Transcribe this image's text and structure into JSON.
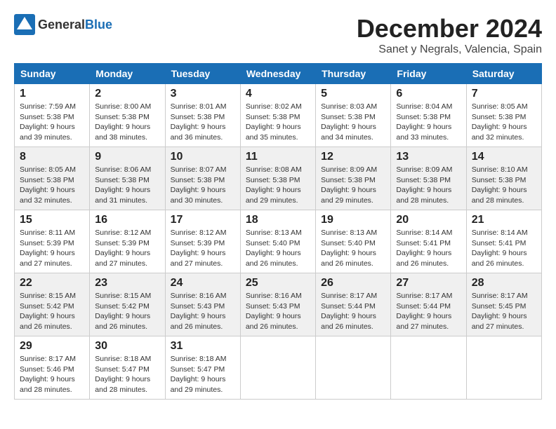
{
  "header": {
    "logo_general": "General",
    "logo_blue": "Blue",
    "month": "December 2024",
    "location": "Sanet y Negrals, Valencia, Spain"
  },
  "weekdays": [
    "Sunday",
    "Monday",
    "Tuesday",
    "Wednesday",
    "Thursday",
    "Friday",
    "Saturday"
  ],
  "weeks": [
    [
      {
        "day": "1",
        "sunrise": "Sunrise: 7:59 AM",
        "sunset": "Sunset: 5:38 PM",
        "daylight": "Daylight: 9 hours and 39 minutes."
      },
      {
        "day": "2",
        "sunrise": "Sunrise: 8:00 AM",
        "sunset": "Sunset: 5:38 PM",
        "daylight": "Daylight: 9 hours and 38 minutes."
      },
      {
        "day": "3",
        "sunrise": "Sunrise: 8:01 AM",
        "sunset": "Sunset: 5:38 PM",
        "daylight": "Daylight: 9 hours and 36 minutes."
      },
      {
        "day": "4",
        "sunrise": "Sunrise: 8:02 AM",
        "sunset": "Sunset: 5:38 PM",
        "daylight": "Daylight: 9 hours and 35 minutes."
      },
      {
        "day": "5",
        "sunrise": "Sunrise: 8:03 AM",
        "sunset": "Sunset: 5:38 PM",
        "daylight": "Daylight: 9 hours and 34 minutes."
      },
      {
        "day": "6",
        "sunrise": "Sunrise: 8:04 AM",
        "sunset": "Sunset: 5:38 PM",
        "daylight": "Daylight: 9 hours and 33 minutes."
      },
      {
        "day": "7",
        "sunrise": "Sunrise: 8:05 AM",
        "sunset": "Sunset: 5:38 PM",
        "daylight": "Daylight: 9 hours and 32 minutes."
      }
    ],
    [
      {
        "day": "8",
        "sunrise": "Sunrise: 8:05 AM",
        "sunset": "Sunset: 5:38 PM",
        "daylight": "Daylight: 9 hours and 32 minutes."
      },
      {
        "day": "9",
        "sunrise": "Sunrise: 8:06 AM",
        "sunset": "Sunset: 5:38 PM",
        "daylight": "Daylight: 9 hours and 31 minutes."
      },
      {
        "day": "10",
        "sunrise": "Sunrise: 8:07 AM",
        "sunset": "Sunset: 5:38 PM",
        "daylight": "Daylight: 9 hours and 30 minutes."
      },
      {
        "day": "11",
        "sunrise": "Sunrise: 8:08 AM",
        "sunset": "Sunset: 5:38 PM",
        "daylight": "Daylight: 9 hours and 29 minutes."
      },
      {
        "day": "12",
        "sunrise": "Sunrise: 8:09 AM",
        "sunset": "Sunset: 5:38 PM",
        "daylight": "Daylight: 9 hours and 29 minutes."
      },
      {
        "day": "13",
        "sunrise": "Sunrise: 8:09 AM",
        "sunset": "Sunset: 5:38 PM",
        "daylight": "Daylight: 9 hours and 28 minutes."
      },
      {
        "day": "14",
        "sunrise": "Sunrise: 8:10 AM",
        "sunset": "Sunset: 5:38 PM",
        "daylight": "Daylight: 9 hours and 28 minutes."
      }
    ],
    [
      {
        "day": "15",
        "sunrise": "Sunrise: 8:11 AM",
        "sunset": "Sunset: 5:39 PM",
        "daylight": "Daylight: 9 hours and 27 minutes."
      },
      {
        "day": "16",
        "sunrise": "Sunrise: 8:12 AM",
        "sunset": "Sunset: 5:39 PM",
        "daylight": "Daylight: 9 hours and 27 minutes."
      },
      {
        "day": "17",
        "sunrise": "Sunrise: 8:12 AM",
        "sunset": "Sunset: 5:39 PM",
        "daylight": "Daylight: 9 hours and 27 minutes."
      },
      {
        "day": "18",
        "sunrise": "Sunrise: 8:13 AM",
        "sunset": "Sunset: 5:40 PM",
        "daylight": "Daylight: 9 hours and 26 minutes."
      },
      {
        "day": "19",
        "sunrise": "Sunrise: 8:13 AM",
        "sunset": "Sunset: 5:40 PM",
        "daylight": "Daylight: 9 hours and 26 minutes."
      },
      {
        "day": "20",
        "sunrise": "Sunrise: 8:14 AM",
        "sunset": "Sunset: 5:41 PM",
        "daylight": "Daylight: 9 hours and 26 minutes."
      },
      {
        "day": "21",
        "sunrise": "Sunrise: 8:14 AM",
        "sunset": "Sunset: 5:41 PM",
        "daylight": "Daylight: 9 hours and 26 minutes."
      }
    ],
    [
      {
        "day": "22",
        "sunrise": "Sunrise: 8:15 AM",
        "sunset": "Sunset: 5:42 PM",
        "daylight": "Daylight: 9 hours and 26 minutes."
      },
      {
        "day": "23",
        "sunrise": "Sunrise: 8:15 AM",
        "sunset": "Sunset: 5:42 PM",
        "daylight": "Daylight: 9 hours and 26 minutes."
      },
      {
        "day": "24",
        "sunrise": "Sunrise: 8:16 AM",
        "sunset": "Sunset: 5:43 PM",
        "daylight": "Daylight: 9 hours and 26 minutes."
      },
      {
        "day": "25",
        "sunrise": "Sunrise: 8:16 AM",
        "sunset": "Sunset: 5:43 PM",
        "daylight": "Daylight: 9 hours and 26 minutes."
      },
      {
        "day": "26",
        "sunrise": "Sunrise: 8:17 AM",
        "sunset": "Sunset: 5:44 PM",
        "daylight": "Daylight: 9 hours and 26 minutes."
      },
      {
        "day": "27",
        "sunrise": "Sunrise: 8:17 AM",
        "sunset": "Sunset: 5:44 PM",
        "daylight": "Daylight: 9 hours and 27 minutes."
      },
      {
        "day": "28",
        "sunrise": "Sunrise: 8:17 AM",
        "sunset": "Sunset: 5:45 PM",
        "daylight": "Daylight: 9 hours and 27 minutes."
      }
    ],
    [
      {
        "day": "29",
        "sunrise": "Sunrise: 8:17 AM",
        "sunset": "Sunset: 5:46 PM",
        "daylight": "Daylight: 9 hours and 28 minutes."
      },
      {
        "day": "30",
        "sunrise": "Sunrise: 8:18 AM",
        "sunset": "Sunset: 5:47 PM",
        "daylight": "Daylight: 9 hours and 28 minutes."
      },
      {
        "day": "31",
        "sunrise": "Sunrise: 8:18 AM",
        "sunset": "Sunset: 5:47 PM",
        "daylight": "Daylight: 9 hours and 29 minutes."
      },
      null,
      null,
      null,
      null
    ]
  ]
}
